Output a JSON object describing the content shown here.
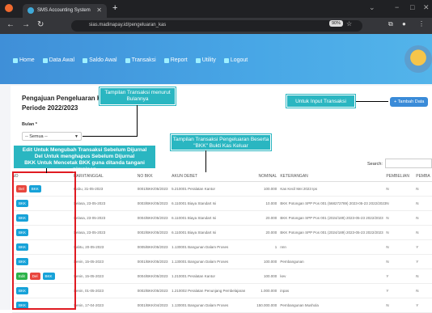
{
  "browser": {
    "tab_title": "SMS Accounting System",
    "url": "sias.madinapay.id/pengeluaran_kas",
    "zoom": "90%"
  },
  "nav": [
    "Home",
    "Data Awal",
    "Saldo Awal",
    "Transaksi",
    "Report",
    "Utility",
    "Logout"
  ],
  "page": {
    "title_line1": "Pengajuan Pengeluaran Kas",
    "title_line2": "Periode 2022/2023",
    "bulan_label": "Bulan *",
    "bulan_value": "-- Semua --",
    "tambah_label": "+ Tambah Data",
    "search_label": "Search:"
  },
  "annotations": {
    "menurut_bulan": "Tampilan Transaksi menurut Bulannya",
    "input_transaksi": "Untuk Input Transaksi",
    "pengeluaran": "Tampilan Transaksi Pengeluaran Beserta \"BKK\" Bukti Kas Keluar",
    "edit_line1": "Edit Untuk Mengubah Transaksi  Sebelum Dijurnal",
    "edit_line2": "Del Untuk menghapus  Sebelum Dijurnal",
    "edit_line3": "BKK Untuk Mencetak BKK guna ditanda tangani pimpinan"
  },
  "table": {
    "headers": [
      "NO",
      "HARI/TANGGAL",
      "NO BKK",
      "AKUN DEBET",
      "NOMINAL",
      "KETERANGAN",
      "PEMBELIAN",
      "PEMBA"
    ],
    "rows": [
      {
        "buttons": [
          "Del",
          "BKK"
        ],
        "no": "",
        "tanggal": "Rabu, 31-05-2023",
        "bkk": "0001/BKK/05/2023",
        "akun": "5.210001 Peralatan Kantor",
        "nominal": "100.000",
        "ket": "Kas Kecil Mei 2023 Ips",
        "pembelian": "N",
        "pemba": "N"
      },
      {
        "buttons": [
          "BKK"
        ],
        "no": "",
        "tanggal": "Selasa, 23-05-2023",
        "bkk": "0003/BKK/05/2023",
        "akun": "6.110001 Biaya Standart Isi",
        "nominal": "10.000",
        "ket": "BKK Potongan SPP Pos 001 (568272789) 2023-05-23 2022/2023",
        "pembelian": "N",
        "pemba": "N"
      },
      {
        "buttons": [
          "BKK"
        ],
        "no": "",
        "tanggal": "Selasa, 23-05-2023",
        "bkk": "0004/BKK/05/2023",
        "akun": "6.110001 Biaya Standart Isi",
        "nominal": "20.000",
        "ket": "BKK Potongan SPP Pos 001 (2024/189) 2023-05-23 2022/2023",
        "pembelian": "N",
        "pemba": "N"
      },
      {
        "buttons": [
          "BKK"
        ],
        "no": "",
        "tanggal": "Selasa, 23-05-2023",
        "bkk": "0002/BKK/05/2023",
        "akun": "6.110001 Biaya Standart Isi",
        "nominal": "20.000",
        "ket": "BKK Potongan SPP Pos 001 (2024/189) 2023-05-23 2022/2023",
        "pembelian": "N",
        "pemba": "N"
      },
      {
        "buttons": [
          "BKK"
        ],
        "no": "",
        "tanggal": "Sabtu, 20-05-2023",
        "bkk": "0005/BKK/05/2023",
        "akun": "1.130001 Bangunan Dalam Proses",
        "nominal": "1",
        "ket": "nnn",
        "pembelian": "N",
        "pemba": "Y"
      },
      {
        "buttons": [
          "BKK"
        ],
        "no": "",
        "tanggal": "Senin, 15-05-2023",
        "bkk": "0001/BKK/05/2023",
        "akun": "1.130001 Bangunan Dalam Proses",
        "nominal": "100.000",
        "ket": "Pembangunan",
        "pembelian": "N",
        "pemba": "Y"
      },
      {
        "buttons": [
          "Edit",
          "Del",
          "BKK"
        ],
        "no": "",
        "tanggal": "Senin, 15-05-2023",
        "bkk": "0004/BKK/05/2023",
        "akun": "1.210001 Peralatan Kantor",
        "nominal": "100.000",
        "ket": "kev",
        "pembelian": "Y",
        "pemba": "N"
      },
      {
        "buttons": [
          "BKK"
        ],
        "no": "",
        "tanggal": "Senin, 01-05-2023",
        "bkk": "0002/BKK/05/2023",
        "akun": "1.210002 Peralatan Penunjang Pembelajaran",
        "nominal": "1.000.000",
        "ket": "inpas",
        "pembelian": "Y",
        "pemba": "N"
      },
      {
        "buttons": [
          "BKK"
        ],
        "no": "",
        "tanggal": "Senin, 17-04-2023",
        "bkk": "0001/BKK/04/2023",
        "akun": "1.130001 Bangunan Dalam Proses",
        "nominal": "150.000.000",
        "ket": "Pembangunan Mushola",
        "pembelian": "N",
        "pemba": "Y"
      }
    ]
  }
}
